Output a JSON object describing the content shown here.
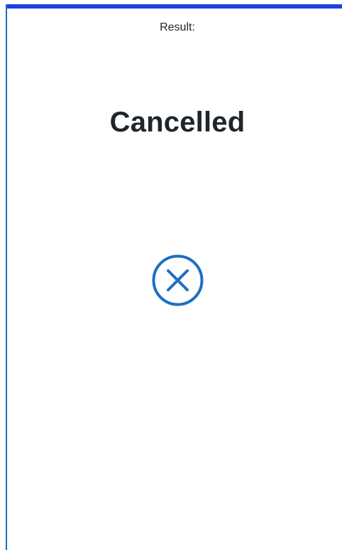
{
  "header": {
    "result_label": "Result:"
  },
  "status": {
    "title": "Cancelled",
    "icon": "close-circle-icon"
  },
  "colors": {
    "top_bar": "#1d3fe0",
    "left_rule": "#1f6fc2",
    "icon": "#1f6fc2",
    "text": "#1f252b"
  }
}
